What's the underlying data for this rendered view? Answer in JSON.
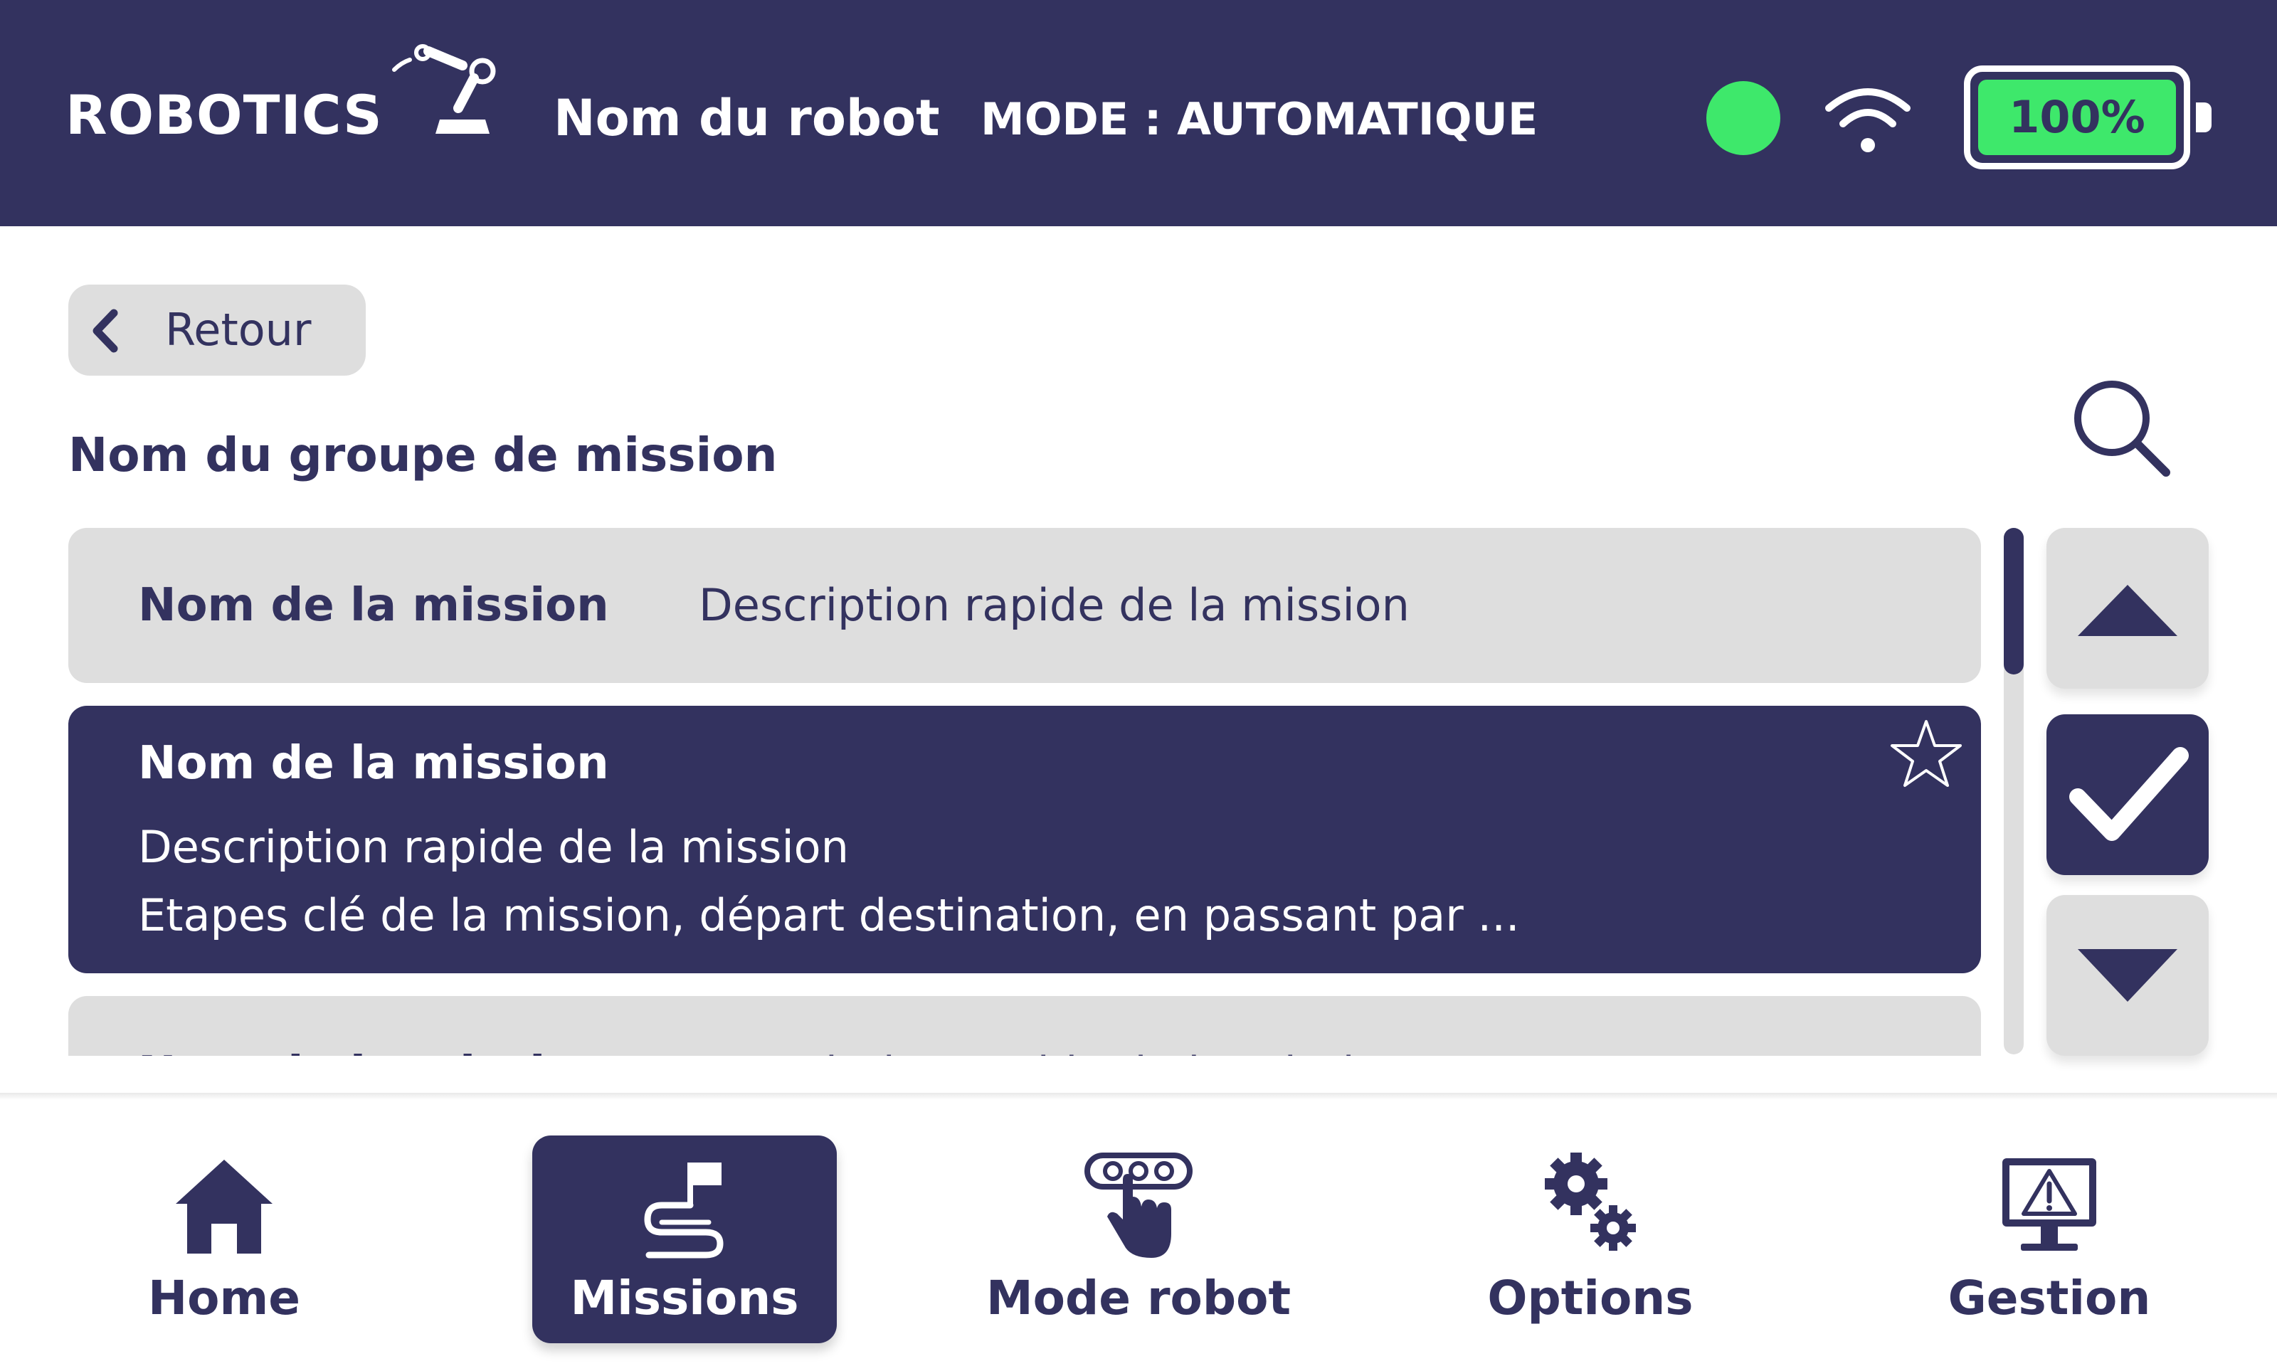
{
  "header": {
    "logo_text": "ROBOTICS",
    "robot_name": "Nom du robot",
    "mode": "MODE : AUTOMATIQUE",
    "status_color": "#3ee86b",
    "battery_label": "100%",
    "battery_level": 1.0
  },
  "back_button": {
    "label": "Retour"
  },
  "group": {
    "title": "Nom du groupe de mission"
  },
  "missions": [
    {
      "name": "Nom de la mission",
      "description": "Description rapide de la mission",
      "selected": false
    },
    {
      "name": "Nom de la mission",
      "description": "Description rapide de la mission",
      "steps": "Etapes clé de la mission, départ destination, en passant par ...",
      "selected": true
    },
    {
      "name": "Nom de la mission",
      "description": "Description rapide de la mission",
      "selected": false
    }
  ],
  "nav": {
    "items": [
      {
        "label": "Home",
        "icon": "home-icon"
      },
      {
        "label": "Missions",
        "icon": "missions-flag-icon",
        "active": true
      },
      {
        "label": "Mode robot",
        "icon": "mode-robot-icon"
      },
      {
        "label": "Options",
        "icon": "gears-icon"
      },
      {
        "label": "Gestion",
        "icon": "monitor-warning-icon"
      }
    ]
  },
  "colors": {
    "primary": "#33325f",
    "surface": "#dedede",
    "status_ok": "#3ee86b",
    "background": "#ffffff"
  }
}
